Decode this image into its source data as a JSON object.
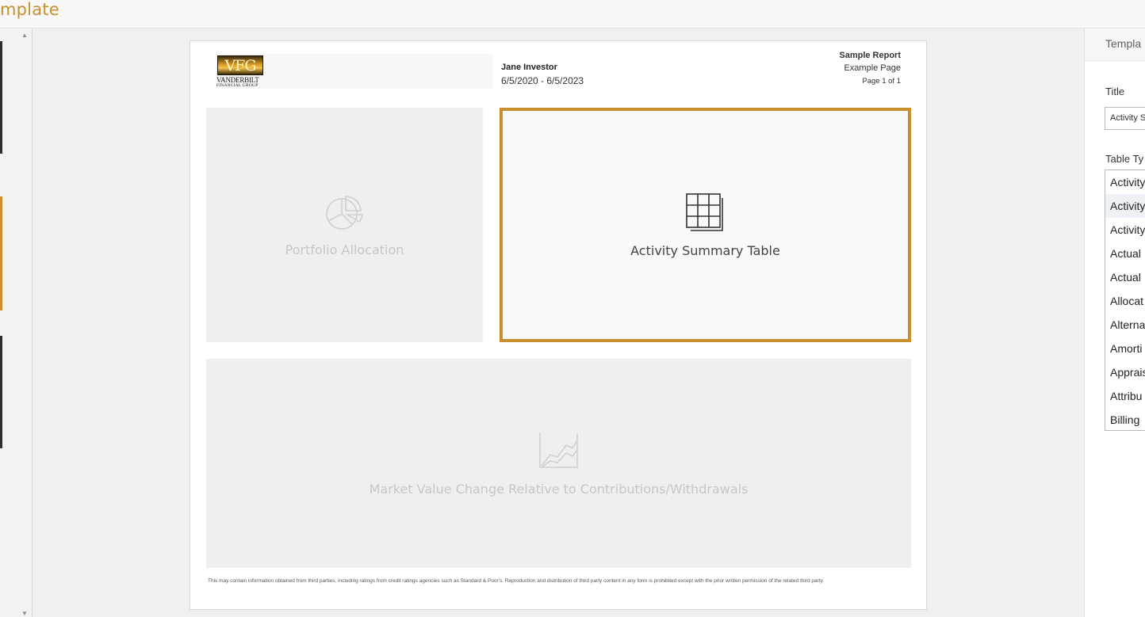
{
  "app": {
    "title": "mplate"
  },
  "report": {
    "logo": {
      "mark": "VFG",
      "line1": "VANDERBILT",
      "line2": "FINANCIAL GROUP"
    },
    "client_name": "Jane Investor",
    "date_range": "6/5/2020 - 6/5/2023",
    "report_name": "Sample Report",
    "page_name": "Example Page",
    "page_number": "Page 1 of 1",
    "blocks": {
      "allocation": "Portfolio Allocation",
      "activity": "Activity Summary Table",
      "market": "Market Value Change Relative to Contributions/Withdrawals"
    },
    "disclaimer": "This may contain information obtained from third parties, including ratings from credit ratings agencies such as Standard & Poor's. Reproduction and distribution of third party content in any form is prohibited except with the prior written permission of the related third party."
  },
  "right_panel": {
    "header": "Templa",
    "title_label": "Title",
    "title_value": "Activity S",
    "type_label": "Table Ty",
    "type_options": [
      "Activity",
      "Activity",
      "Activity",
      "Actual",
      "Actual",
      "Allocat",
      "Alterna",
      "Amorti",
      "Apprais",
      "Attribu",
      "Billing"
    ]
  },
  "colors": {
    "accent": "#c8902c",
    "block_bg": "#efefef",
    "canvas_bg": "#f0f0f0"
  },
  "icons": {
    "allocation": "pie-chart-icon",
    "activity": "table-grid-icon",
    "market": "line-chart-icon"
  }
}
